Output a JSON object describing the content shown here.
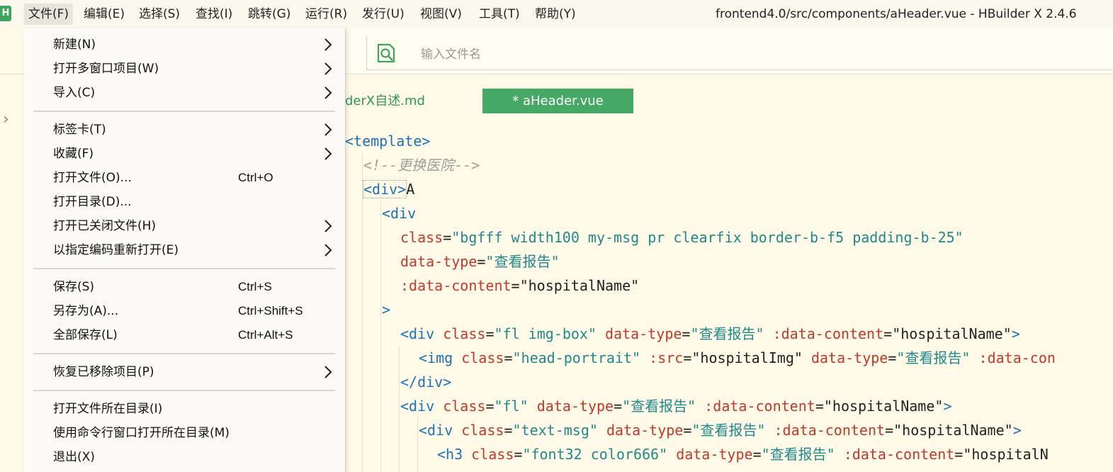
{
  "app": {
    "logo_letter": "H",
    "window_title": "frontend4.0/src/components/aHeader.vue - HBuilder X 2.4.6"
  },
  "menubar": {
    "items": [
      "文件(F)",
      "编辑(E)",
      "选择(S)",
      "查找(I)",
      "跳转(G)",
      "运行(R)",
      "发行(U)",
      "视图(V)",
      "工具(T)",
      "帮助(Y)"
    ]
  },
  "search": {
    "placeholder": "输入文件名"
  },
  "tabs": {
    "inactive": "derX自述.md",
    "active": "* aHeader.vue"
  },
  "file_menu": {
    "items": [
      {
        "label": "新建(N)",
        "shortcut": "",
        "submenu": true
      },
      {
        "label": "打开多窗口项目(W)",
        "shortcut": "",
        "submenu": true
      },
      {
        "label": "导入(C)",
        "shortcut": "",
        "submenu": true
      },
      {
        "label": "标签卡(T)",
        "shortcut": "",
        "submenu": true
      },
      {
        "label": "收藏(F)",
        "shortcut": "",
        "submenu": true
      },
      {
        "label": "打开文件(O)...",
        "shortcut": "Ctrl+O",
        "submenu": false
      },
      {
        "label": "打开目录(D)...",
        "shortcut": "",
        "submenu": false
      },
      {
        "label": "打开已关闭文件(H)",
        "shortcut": "",
        "submenu": true
      },
      {
        "label": "以指定编码重新打开(E)",
        "shortcut": "",
        "submenu": true
      },
      {
        "label": "保存(S)",
        "shortcut": "Ctrl+S",
        "submenu": false
      },
      {
        "label": "另存为(A)...",
        "shortcut": "Ctrl+Shift+S",
        "submenu": false
      },
      {
        "label": "全部保存(L)",
        "shortcut": "Ctrl+Alt+S",
        "submenu": false
      },
      {
        "label": "恢复已移除项目(P)",
        "shortcut": "",
        "submenu": true
      },
      {
        "label": "打开文件所在目录(I)",
        "shortcut": "",
        "submenu": false
      },
      {
        "label": "使用命令行窗口打开所在目录(M)",
        "shortcut": "",
        "submenu": false
      },
      {
        "label": "退出(X)",
        "shortcut": "",
        "submenu": false
      }
    ]
  },
  "code": {
    "lines": [
      [
        {
          "t": "<template>",
          "c": "tag"
        }
      ],
      [
        {
          "t": "<!--更换医院-->",
          "c": "comment"
        }
      ],
      [
        {
          "t": "<div>",
          "c": "tag",
          "box": true
        },
        {
          "t": "A",
          "c": "plain"
        }
      ],
      [
        {
          "t": "<div",
          "c": "tag"
        }
      ],
      [
        {
          "t": "class",
          "c": "attr"
        },
        {
          "t": "=",
          "c": "plain"
        },
        {
          "t": "\"bgfff width100 my-msg pr clearfix border-b-f5 padding-b-25\"",
          "c": "str"
        }
      ],
      [
        {
          "t": "data-type",
          "c": "attr"
        },
        {
          "t": "=",
          "c": "plain"
        },
        {
          "t": "\"查看报告\"",
          "c": "str"
        }
      ],
      [
        {
          "t": ":data-content",
          "c": "attr"
        },
        {
          "t": "=",
          "c": "plain"
        },
        {
          "t": "\"hospitalName\"",
          "c": "plain"
        }
      ],
      [
        {
          "t": ">",
          "c": "tag"
        }
      ],
      [
        {
          "t": "<div ",
          "c": "tag"
        },
        {
          "t": "class",
          "c": "attr"
        },
        {
          "t": "=",
          "c": "plain"
        },
        {
          "t": "\"fl img-box\"",
          "c": "str"
        },
        {
          "t": " ",
          "c": "plain"
        },
        {
          "t": "data-type",
          "c": "attr"
        },
        {
          "t": "=",
          "c": "plain"
        },
        {
          "t": "\"查看报告\"",
          "c": "str"
        },
        {
          "t": " ",
          "c": "plain"
        },
        {
          "t": ":data-content",
          "c": "attr"
        },
        {
          "t": "=",
          "c": "plain"
        },
        {
          "t": "\"hospitalName\"",
          "c": "plain"
        },
        {
          "t": ">",
          "c": "tag"
        }
      ],
      [
        {
          "t": "<img ",
          "c": "tag"
        },
        {
          "t": "class",
          "c": "attr"
        },
        {
          "t": "=",
          "c": "plain"
        },
        {
          "t": "\"head-portrait\"",
          "c": "str"
        },
        {
          "t": " ",
          "c": "plain"
        },
        {
          "t": ":src",
          "c": "attr"
        },
        {
          "t": "=",
          "c": "plain"
        },
        {
          "t": "\"hospitalImg\"",
          "c": "plain"
        },
        {
          "t": " ",
          "c": "plain"
        },
        {
          "t": "data-type",
          "c": "attr"
        },
        {
          "t": "=",
          "c": "plain"
        },
        {
          "t": "\"查看报告\"",
          "c": "str"
        },
        {
          "t": " ",
          "c": "plain"
        },
        {
          "t": ":data-con",
          "c": "attr"
        }
      ],
      [
        {
          "t": "</div>",
          "c": "tag"
        }
      ],
      [
        {
          "t": "<div ",
          "c": "tag"
        },
        {
          "t": "class",
          "c": "attr"
        },
        {
          "t": "=",
          "c": "plain"
        },
        {
          "t": "\"fl\"",
          "c": "str"
        },
        {
          "t": " ",
          "c": "plain"
        },
        {
          "t": "data-type",
          "c": "attr"
        },
        {
          "t": "=",
          "c": "plain"
        },
        {
          "t": "\"查看报告\"",
          "c": "str"
        },
        {
          "t": " ",
          "c": "plain"
        },
        {
          "t": ":data-content",
          "c": "attr"
        },
        {
          "t": "=",
          "c": "plain"
        },
        {
          "t": "\"hospitalName\"",
          "c": "plain"
        },
        {
          "t": ">",
          "c": "tag"
        }
      ],
      [
        {
          "t": "<div ",
          "c": "tag"
        },
        {
          "t": "class",
          "c": "attr"
        },
        {
          "t": "=",
          "c": "plain"
        },
        {
          "t": "\"text-msg\"",
          "c": "str"
        },
        {
          "t": " ",
          "c": "plain"
        },
        {
          "t": "data-type",
          "c": "attr"
        },
        {
          "t": "=",
          "c": "plain"
        },
        {
          "t": "\"查看报告\"",
          "c": "str"
        },
        {
          "t": " ",
          "c": "plain"
        },
        {
          "t": ":data-content",
          "c": "attr"
        },
        {
          "t": "=",
          "c": "plain"
        },
        {
          "t": "\"hospitalName\"",
          "c": "plain"
        },
        {
          "t": ">",
          "c": "tag"
        }
      ],
      [
        {
          "t": "<h3 ",
          "c": "tag"
        },
        {
          "t": "class",
          "c": "attr"
        },
        {
          "t": "=",
          "c": "plain"
        },
        {
          "t": "\"font32 color666\"",
          "c": "str"
        },
        {
          "t": " ",
          "c": "plain"
        },
        {
          "t": "data-type",
          "c": "attr"
        },
        {
          "t": "=",
          "c": "plain"
        },
        {
          "t": "\"查看报告\"",
          "c": "str"
        },
        {
          "t": " ",
          "c": "plain"
        },
        {
          "t": ":data-content",
          "c": "attr"
        },
        {
          "t": "=",
          "c": "plain"
        },
        {
          "t": "\"hospitalN",
          "c": "plain"
        }
      ]
    ]
  },
  "colors": {
    "accent_green": "#45a865",
    "tag_blue": "#1a73b8",
    "attr_red": "#c0392b",
    "string_teal": "#1f8a8a"
  }
}
